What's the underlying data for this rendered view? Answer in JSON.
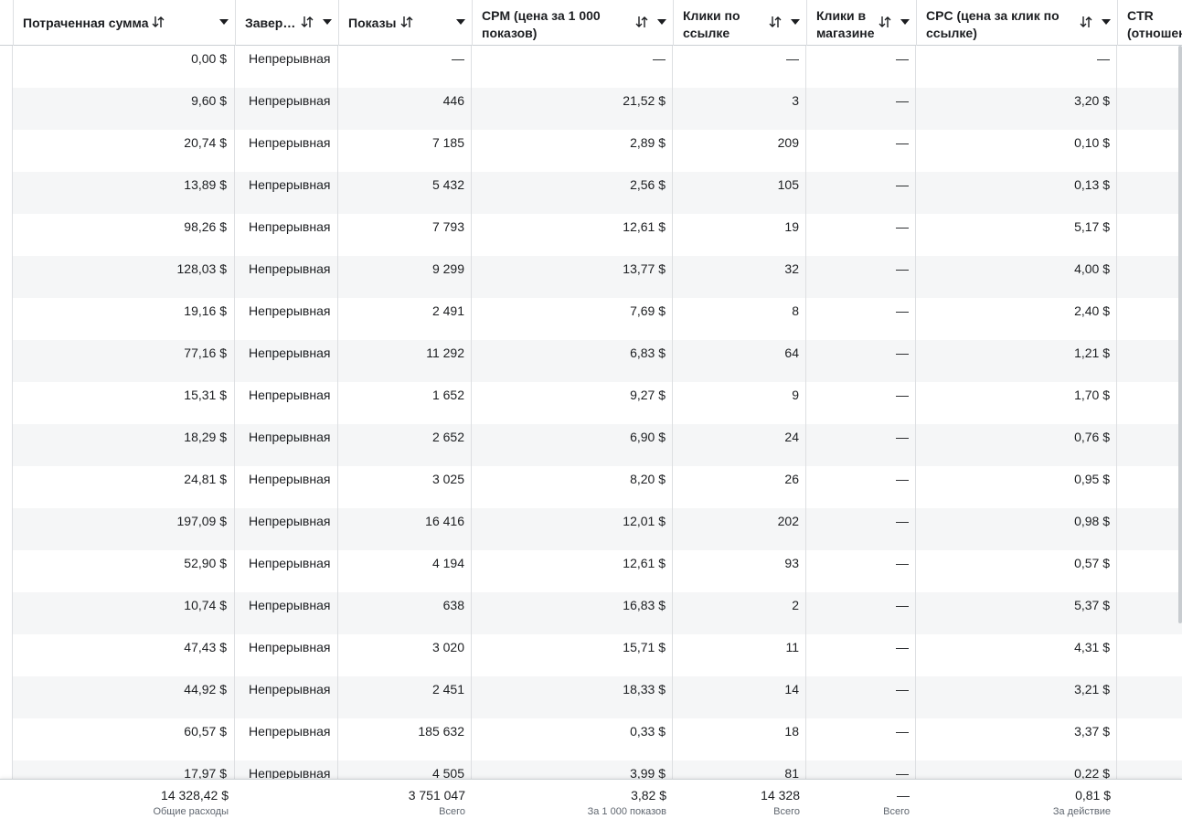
{
  "columns": [
    {
      "key": "spent",
      "title": "Потраченная сумма"
    },
    {
      "key": "end",
      "title": "Завер…"
    },
    {
      "key": "impressions",
      "title": "Показы"
    },
    {
      "key": "cpm",
      "title": "CPM (цена за 1 000 показов)"
    },
    {
      "key": "link_clicks",
      "title": "Клики по ссылке"
    },
    {
      "key": "shop_clicks",
      "title": "Клики в магазине"
    },
    {
      "key": "cpc",
      "title": "CPC (цена за клик по ссылке)"
    },
    {
      "key": "ctr",
      "title": "CTR (отношен"
    }
  ],
  "rows": [
    {
      "spent": "0,00 $",
      "end": "Непрерывная",
      "impressions": "—",
      "cpm": "—",
      "link_clicks": "—",
      "shop_clicks": "—",
      "cpc": "—"
    },
    {
      "spent": "9,60 $",
      "end": "Непрерывная",
      "impressions": "446",
      "cpm": "21,52 $",
      "link_clicks": "3",
      "shop_clicks": "—",
      "cpc": "3,20 $"
    },
    {
      "spent": "20,74 $",
      "end": "Непрерывная",
      "impressions": "7 185",
      "cpm": "2,89 $",
      "link_clicks": "209",
      "shop_clicks": "—",
      "cpc": "0,10 $"
    },
    {
      "spent": "13,89 $",
      "end": "Непрерывная",
      "impressions": "5 432",
      "cpm": "2,56 $",
      "link_clicks": "105",
      "shop_clicks": "—",
      "cpc": "0,13 $"
    },
    {
      "spent": "98,26 $",
      "end": "Непрерывная",
      "impressions": "7 793",
      "cpm": "12,61 $",
      "link_clicks": "19",
      "shop_clicks": "—",
      "cpc": "5,17 $"
    },
    {
      "spent": "128,03 $",
      "end": "Непрерывная",
      "impressions": "9 299",
      "cpm": "13,77 $",
      "link_clicks": "32",
      "shop_clicks": "—",
      "cpc": "4,00 $"
    },
    {
      "spent": "19,16 $",
      "end": "Непрерывная",
      "impressions": "2 491",
      "cpm": "7,69 $",
      "link_clicks": "8",
      "shop_clicks": "—",
      "cpc": "2,40 $"
    },
    {
      "spent": "77,16 $",
      "end": "Непрерывная",
      "impressions": "11 292",
      "cpm": "6,83 $",
      "link_clicks": "64",
      "shop_clicks": "—",
      "cpc": "1,21 $"
    },
    {
      "spent": "15,31 $",
      "end": "Непрерывная",
      "impressions": "1 652",
      "cpm": "9,27 $",
      "link_clicks": "9",
      "shop_clicks": "—",
      "cpc": "1,70 $"
    },
    {
      "spent": "18,29 $",
      "end": "Непрерывная",
      "impressions": "2 652",
      "cpm": "6,90 $",
      "link_clicks": "24",
      "shop_clicks": "—",
      "cpc": "0,76 $"
    },
    {
      "spent": "24,81 $",
      "end": "Непрерывная",
      "impressions": "3 025",
      "cpm": "8,20 $",
      "link_clicks": "26",
      "shop_clicks": "—",
      "cpc": "0,95 $"
    },
    {
      "spent": "197,09 $",
      "end": "Непрерывная",
      "impressions": "16 416",
      "cpm": "12,01 $",
      "link_clicks": "202",
      "shop_clicks": "—",
      "cpc": "0,98 $"
    },
    {
      "spent": "52,90 $",
      "end": "Непрерывная",
      "impressions": "4 194",
      "cpm": "12,61 $",
      "link_clicks": "93",
      "shop_clicks": "—",
      "cpc": "0,57 $"
    },
    {
      "spent": "10,74 $",
      "end": "Непрерывная",
      "impressions": "638",
      "cpm": "16,83 $",
      "link_clicks": "2",
      "shop_clicks": "—",
      "cpc": "5,37 $"
    },
    {
      "spent": "47,43 $",
      "end": "Непрерывная",
      "impressions": "3 020",
      "cpm": "15,71 $",
      "link_clicks": "11",
      "shop_clicks": "—",
      "cpc": "4,31 $"
    },
    {
      "spent": "44,92 $",
      "end": "Непрерывная",
      "impressions": "2 451",
      "cpm": "18,33 $",
      "link_clicks": "14",
      "shop_clicks": "—",
      "cpc": "3,21 $"
    },
    {
      "spent": "60,57 $",
      "end": "Непрерывная",
      "impressions": "185 632",
      "cpm": "0,33 $",
      "link_clicks": "18",
      "shop_clicks": "—",
      "cpc": "3,37 $"
    },
    {
      "spent": "17,97 $",
      "end": "Непрерывная",
      "impressions": "4 505",
      "cpm": "3,99 $",
      "link_clicks": "81",
      "shop_clicks": "—",
      "cpc": "0,22 $"
    }
  ],
  "totals": {
    "spent": {
      "value": "14 328,42 $",
      "label": "Общие расходы"
    },
    "impressions": {
      "value": "3 751 047",
      "label": "Всего"
    },
    "cpm": {
      "value": "3,82 $",
      "label": "За 1 000 показов"
    },
    "link_clicks": {
      "value": "14 328",
      "label": "Всего"
    },
    "shop_clicks": {
      "value": "—",
      "label": "Всего"
    },
    "cpc": {
      "value": "0,81 $",
      "label": "За действие"
    }
  },
  "icons": {
    "sort": "sort-arrows-icon",
    "caret": "caret-down-icon"
  },
  "colors": {
    "row_alt": "#f5f6f7",
    "border": "#dddfe2",
    "text": "#1c1e21",
    "muted": "#606770"
  }
}
